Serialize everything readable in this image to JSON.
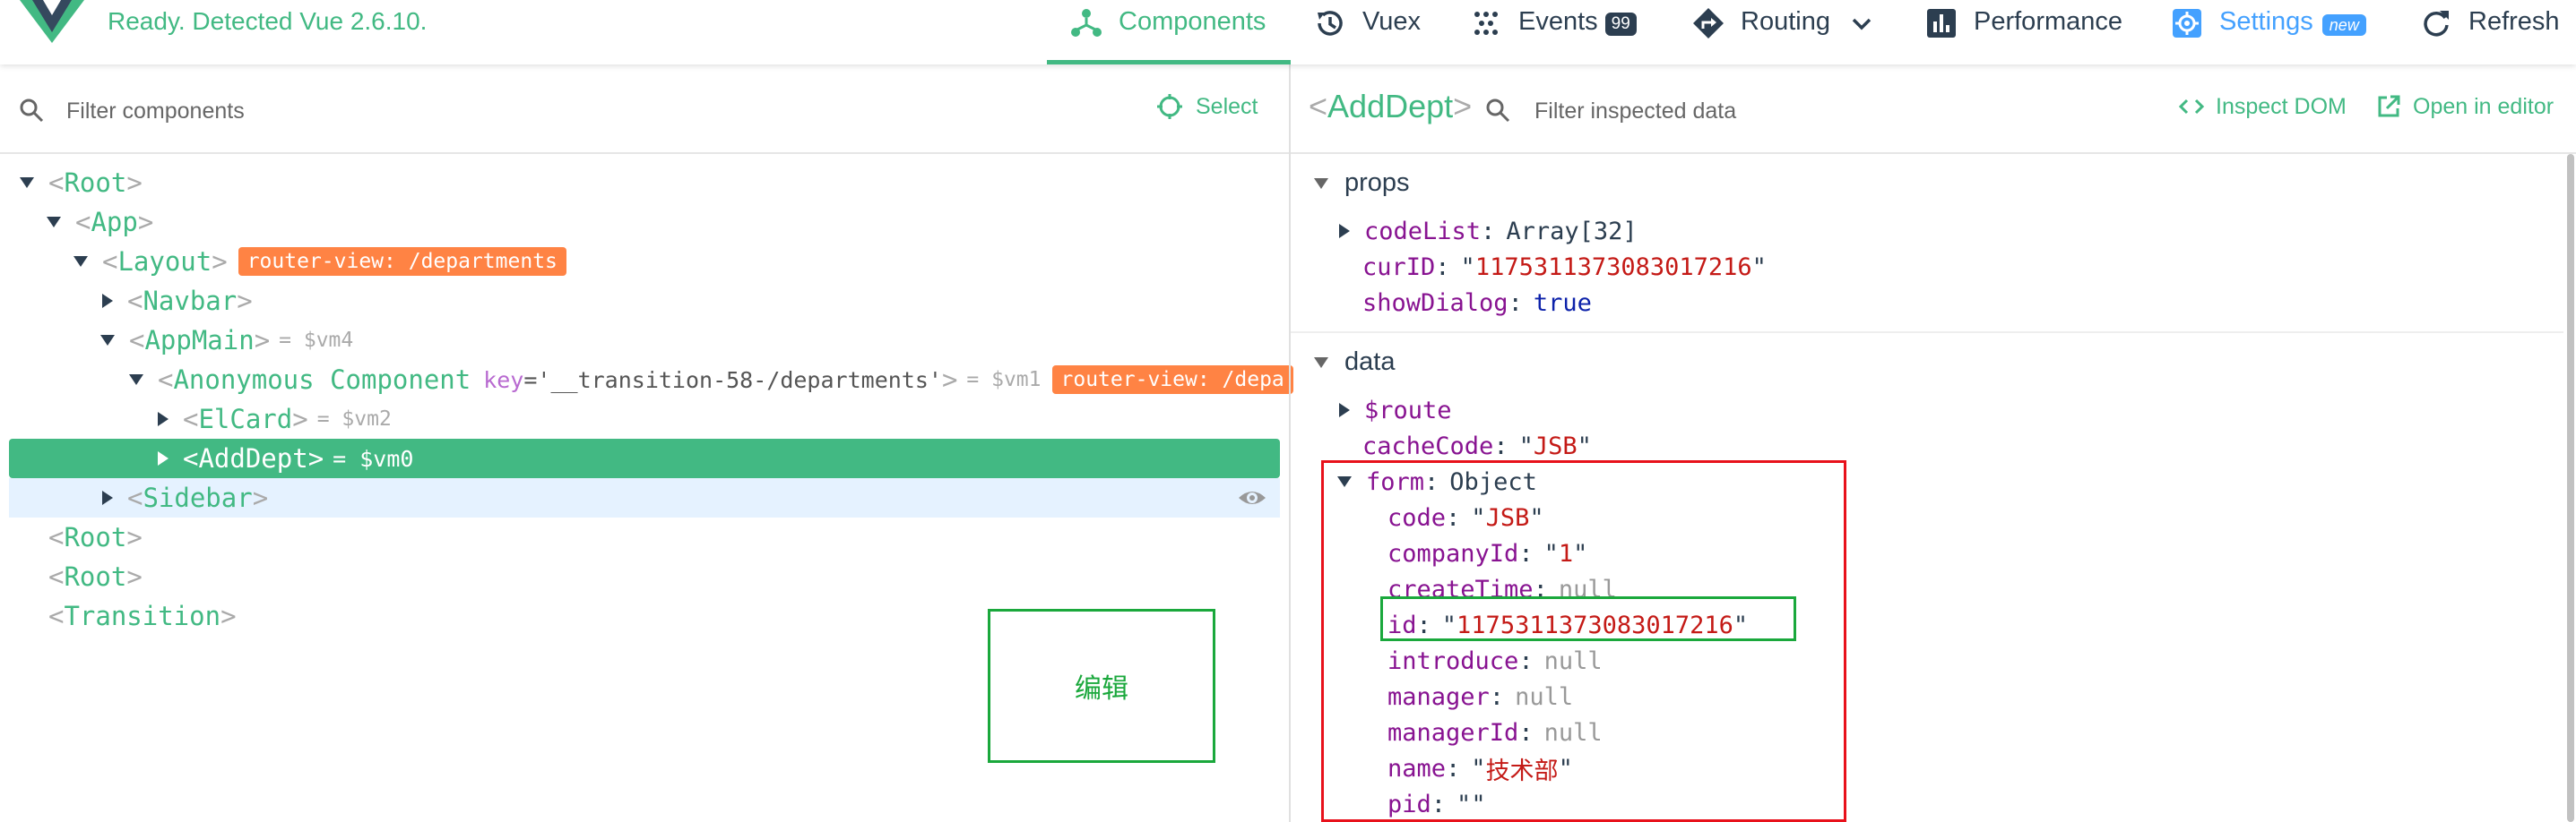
{
  "header": {
    "status": "Ready. Detected Vue 2.6.10.",
    "tabs": [
      {
        "label": "Components",
        "icon": "components-icon",
        "active": true
      },
      {
        "label": "Vuex",
        "icon": "history-icon"
      },
      {
        "label": "Events",
        "icon": "events-icon",
        "badge": "99"
      },
      {
        "label": "Routing",
        "icon": "routing-icon"
      },
      {
        "label": "Performance",
        "icon": "bar-chart-icon"
      },
      {
        "label": "Settings",
        "icon": "gear-icon",
        "badge": "new"
      },
      {
        "label": "Refresh",
        "icon": "refresh-icon"
      }
    ],
    "accent": "#42b983"
  },
  "left": {
    "filter_placeholder": "Filter components",
    "select_label": "Select",
    "tree": [
      {
        "name": "Root",
        "expanded": true
      },
      {
        "name": "App",
        "expanded": true
      },
      {
        "name": "Layout",
        "expanded": true,
        "badge": "router-view: /departments"
      },
      {
        "name": "Navbar",
        "expanded": false
      },
      {
        "name": "AppMain",
        "expanded": true,
        "vm": "= $vm4"
      },
      {
        "name": "Anonymous Component",
        "expanded": true,
        "key_attr": "key",
        "key_value": "='__transition-58-/departments'",
        "vm": "= $vm1",
        "badge": "router-view: /depa"
      },
      {
        "name": "ElCard",
        "expanded": false,
        "vm": "= $vm2"
      },
      {
        "name": "AddDept",
        "expanded": false,
        "vm": "= $vm0",
        "selected": true
      },
      {
        "name": "Sidebar",
        "expanded": false
      },
      {
        "name": "Root"
      },
      {
        "name": "Root"
      },
      {
        "name": "Transition"
      }
    ],
    "annotation_label": "编辑"
  },
  "right": {
    "component_name": "AddDept",
    "filter_placeholder": "Filter inspected data",
    "inspect_dom_label": "Inspect DOM",
    "open_editor_label": "Open in editor",
    "props_title": "props",
    "props": {
      "codeList": {
        "key": "codeList",
        "value": "Array[32]"
      },
      "curID": {
        "key": "curID",
        "value": "1175311373083017216"
      },
      "showDialog": {
        "key": "showDialog",
        "value": "true"
      }
    },
    "data_title": "data",
    "data": {
      "route": {
        "key": "$route"
      },
      "cacheCode": {
        "key": "cacheCode",
        "value": "JSB"
      },
      "form": {
        "key": "form",
        "value": "Object"
      },
      "code": {
        "key": "code",
        "value": "JSB"
      },
      "companyId": {
        "key": "companyId",
        "value": "1"
      },
      "createTime": {
        "key": "createTime",
        "value": "null"
      },
      "id": {
        "key": "id",
        "value": "1175311373083017216"
      },
      "introduce": {
        "key": "introduce",
        "value": "null"
      },
      "manager": {
        "key": "manager",
        "value": "null"
      },
      "managerId": {
        "key": "managerId",
        "value": "null"
      },
      "name": {
        "key": "name",
        "value": "技术部"
      },
      "pid": {
        "key": "pid",
        "value": ""
      }
    }
  },
  "colors": {
    "red_highlight": "#e8111b",
    "green_highlight": "#1aa83c",
    "router_badge": "#ff8344"
  }
}
